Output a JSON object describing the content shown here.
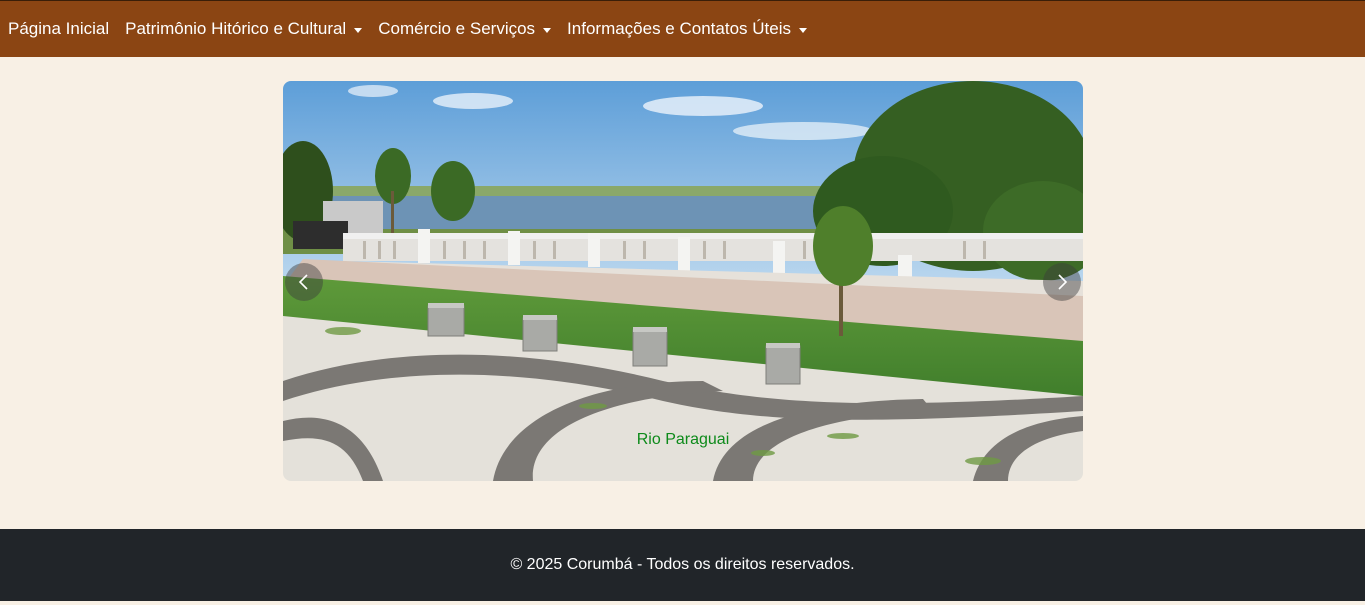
{
  "navbar": {
    "items": [
      {
        "label": "Página Inicial",
        "dropdown": false
      },
      {
        "label": "Patrimônio Hitórico e Cultural",
        "dropdown": true
      },
      {
        "label": "Comércio e Serviços",
        "dropdown": true
      },
      {
        "label": "Informações e Contatos Úteis",
        "dropdown": true
      }
    ]
  },
  "carousel": {
    "caption": "Rio Paraguai",
    "prev_icon": "chevron-left-icon",
    "next_icon": "chevron-right-icon"
  },
  "footer": {
    "text": "© 2025 Corumbá - Todos os direitos reservados."
  },
  "colors": {
    "navbar_bg": "#8b4513",
    "page_bg": "#f8f0e5",
    "footer_bg": "#212529",
    "caption": "#0d8a1a"
  }
}
